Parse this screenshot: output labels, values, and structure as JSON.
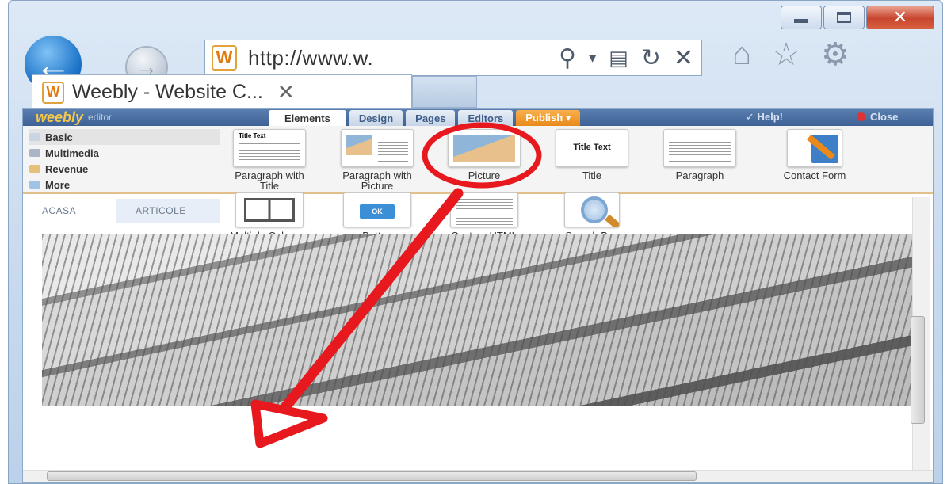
{
  "browser": {
    "address_url": "http://www.w.",
    "tab_title": "Weebly - Website C...",
    "tab_close": "✕",
    "back_glyph": "←",
    "forward_glyph": "→",
    "icons": [
      "search-icon",
      "dropdown-icon",
      "compatibility-icon",
      "refresh-icon",
      "stop-icon",
      "home-icon",
      "favorites-icon",
      "settings-icon"
    ],
    "site_icon_letter": "W"
  },
  "weebly": {
    "logo": "weebly",
    "logo_sub": "editor",
    "tabs": [
      "Elements",
      "Design",
      "Pages",
      "Editors",
      "Publish ▾"
    ],
    "help": "Help!",
    "close": "Close",
    "categories": [
      "Basic",
      "Multimedia",
      "Revenue",
      "More"
    ],
    "elements": [
      {
        "label": "Paragraph with Title",
        "thumb_text": "Title Text"
      },
      {
        "label": "Paragraph with Picture"
      },
      {
        "label": "Picture"
      },
      {
        "label": "Title",
        "thumb_text": "Title Text"
      },
      {
        "label": "Paragraph"
      },
      {
        "label": "Contact Form"
      },
      {
        "label": "Multiple Columns"
      },
      {
        "label": "Button",
        "thumb_text": "OK"
      },
      {
        "label": "Custom HTML"
      },
      {
        "label": "Search Box"
      }
    ],
    "page_nav": [
      "ACASA",
      "ARTICOLE"
    ]
  },
  "colors": {
    "annotation": "#e8191e",
    "publish": "#e98a1b",
    "weebly_bar": "#3e6296"
  }
}
